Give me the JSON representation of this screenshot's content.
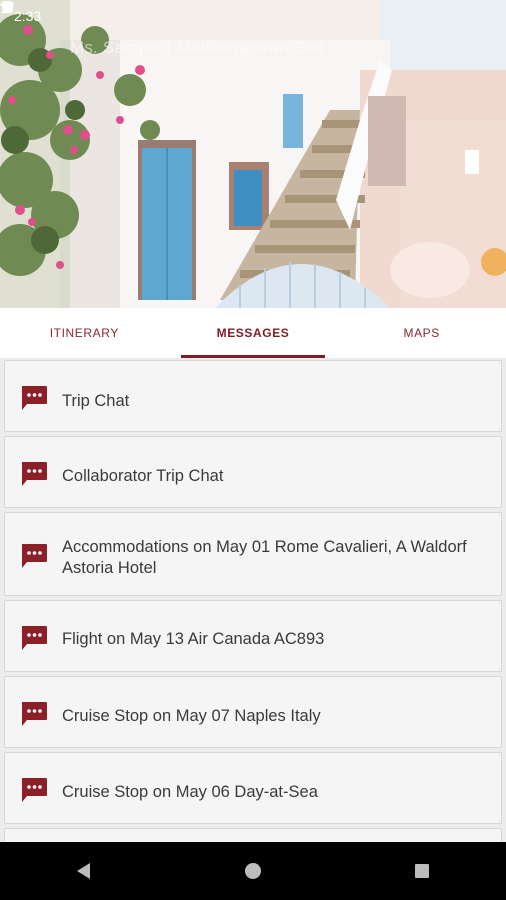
{
  "status_bar": {
    "time": "2:33"
  },
  "header": {
    "trip_title": "Ms. Sample | Mediterranean Sea"
  },
  "tabs": [
    {
      "label": "ITINERARY",
      "active": false
    },
    {
      "label": "MESSAGES",
      "active": true
    },
    {
      "label": "MAPS",
      "active": false
    }
  ],
  "messages": [
    {
      "label": "Trip Chat",
      "icon": "chat-bubble-icon"
    },
    {
      "label": "Collaborator Trip Chat",
      "icon": "chat-bubble-icon"
    },
    {
      "label": "Accommodations on May 01 Rome Cavalieri, A Waldorf Astoria Hotel",
      "icon": "chat-bubble-icon"
    },
    {
      "label": "Flight on May 13 Air Canada AC893",
      "icon": "chat-bubble-icon"
    },
    {
      "label": "Cruise Stop on May 07 Naples Italy",
      "icon": "chat-bubble-icon"
    },
    {
      "label": "Cruise Stop on May 06 Day-at-Sea",
      "icon": "chat-bubble-icon"
    }
  ],
  "colors": {
    "accent": "#7e1d27",
    "icon": "#8b2028"
  }
}
